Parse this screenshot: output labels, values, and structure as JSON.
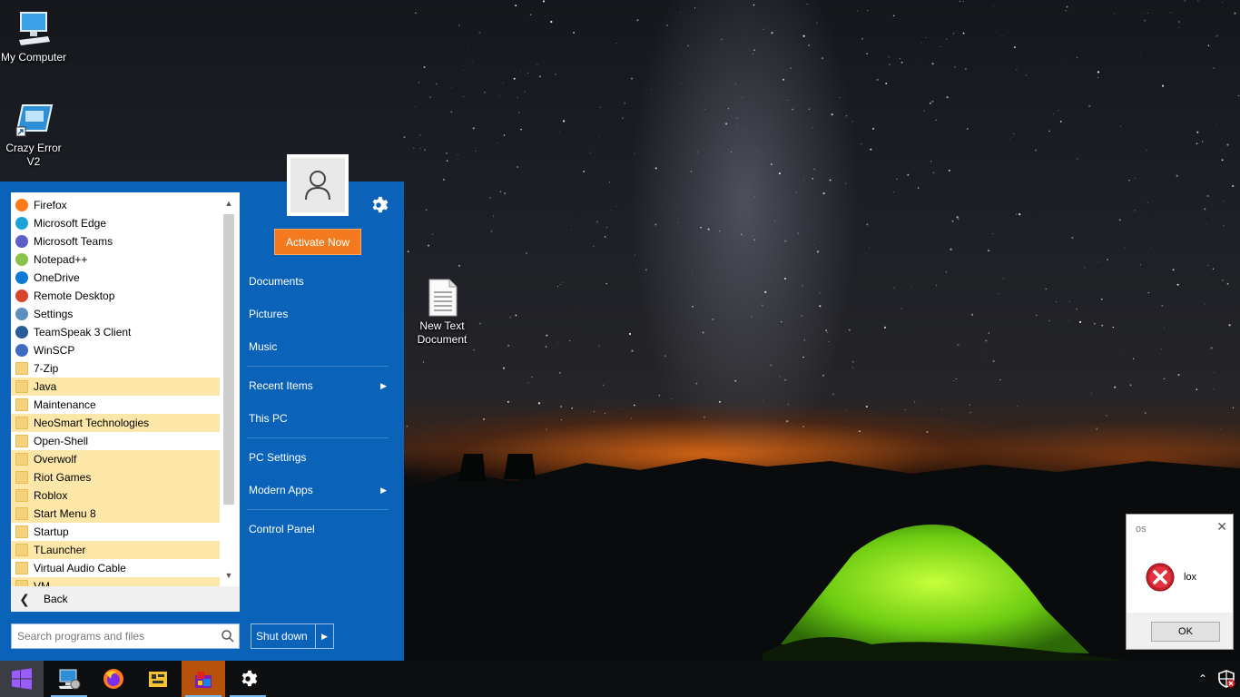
{
  "desktop": {
    "icons": [
      {
        "label": "My Computer",
        "icon": "computer-icon"
      },
      {
        "label": "Crazy Error V2",
        "icon": "shortcut-app-icon"
      },
      {
        "label": "New Text Document",
        "icon": "text-document-icon"
      }
    ]
  },
  "start_menu": {
    "activate_label": "Activate Now",
    "programs": [
      {
        "label": "Firefox",
        "icon": "firefox-icon",
        "folder": false
      },
      {
        "label": "Microsoft Edge",
        "icon": "edge-icon",
        "folder": false
      },
      {
        "label": "Microsoft Teams",
        "icon": "teams-icon",
        "folder": false
      },
      {
        "label": "Notepad++",
        "icon": "notepadpp-icon",
        "folder": false
      },
      {
        "label": "OneDrive",
        "icon": "onedrive-icon",
        "folder": false
      },
      {
        "label": "Remote Desktop",
        "icon": "remote-desktop-icon",
        "folder": false
      },
      {
        "label": "Settings",
        "icon": "settings-app-icon",
        "folder": false
      },
      {
        "label": "TeamSpeak 3 Client",
        "icon": "teamspeak-icon",
        "folder": false
      },
      {
        "label": "WinSCP",
        "icon": "winscp-icon",
        "folder": false
      },
      {
        "label": "7-Zip",
        "icon": "folder-icon",
        "folder": true
      },
      {
        "label": "Java",
        "icon": "folder-icon",
        "folder": true
      },
      {
        "label": "Maintenance",
        "icon": "folder-icon",
        "folder": true
      },
      {
        "label": "NeoSmart Technologies",
        "icon": "folder-icon",
        "folder": true
      },
      {
        "label": "Open-Shell",
        "icon": "folder-icon",
        "folder": true
      },
      {
        "label": "Overwolf",
        "icon": "folder-icon",
        "folder": true
      },
      {
        "label": "Riot Games",
        "icon": "folder-icon",
        "folder": true
      },
      {
        "label": "Roblox",
        "icon": "folder-icon",
        "folder": true
      },
      {
        "label": "Start Menu 8",
        "icon": "folder-icon",
        "folder": true
      },
      {
        "label": "Startup",
        "icon": "folder-icon",
        "folder": true
      },
      {
        "label": "TLauncher",
        "icon": "folder-icon",
        "folder": true
      },
      {
        "label": "Virtual Audio Cable",
        "icon": "folder-icon",
        "folder": true
      },
      {
        "label": "VM",
        "icon": "folder-icon",
        "folder": true
      }
    ],
    "back_label": "Back",
    "right_links": {
      "documents": "Documents",
      "pictures": "Pictures",
      "music": "Music",
      "recent_items": "Recent Items",
      "this_pc": "This PC",
      "pc_settings": "PC Settings",
      "modern_apps": "Modern Apps",
      "control_panel": "Control Panel"
    },
    "search_placeholder": "Search programs and files",
    "shutdown_label": "Shut down"
  },
  "dialog": {
    "title": "os",
    "message": "lox",
    "ok_label": "OK"
  },
  "taskbar": {
    "items": [
      "start-button",
      "my-computer-app",
      "firefox",
      "winscp-folder-app",
      "crazy-error-app",
      "settings"
    ]
  },
  "colors": {
    "start_menu_bg": "#0a63b8",
    "activate_button": "#f47a1f",
    "highlight_row": "#fde7a8",
    "taskbar_bg": "#0e0f10"
  }
}
